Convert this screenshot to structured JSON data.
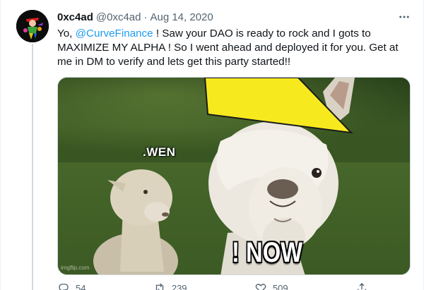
{
  "tweet": {
    "display_name": "0xc4ad",
    "handle": "@0xc4ad",
    "separator": "·",
    "date": "Aug 14, 2020",
    "text_before": "Yo, ",
    "mention": "@CurveFinance",
    "text_after": " ! Saw your DAO is ready to rock and I gots to MAXIMIZE MY ALPHA ! So I went ahead and deployed it for you. Get at me in DM to verify and lets get this party started!!"
  },
  "media": {
    "caption_small": ".WEN",
    "caption_large": "! NOW",
    "watermark": "imgflip.com"
  },
  "actions": {
    "replies": "54",
    "retweets": "239",
    "likes": "509"
  },
  "icons": [
    "avatar",
    "more-icon",
    "reply-icon",
    "retweet-icon",
    "like-icon",
    "share-icon"
  ],
  "colors": {
    "link": "#1d9bf0",
    "muted": "#536471",
    "text": "#0f1419",
    "hat": "#f6ea1f"
  }
}
